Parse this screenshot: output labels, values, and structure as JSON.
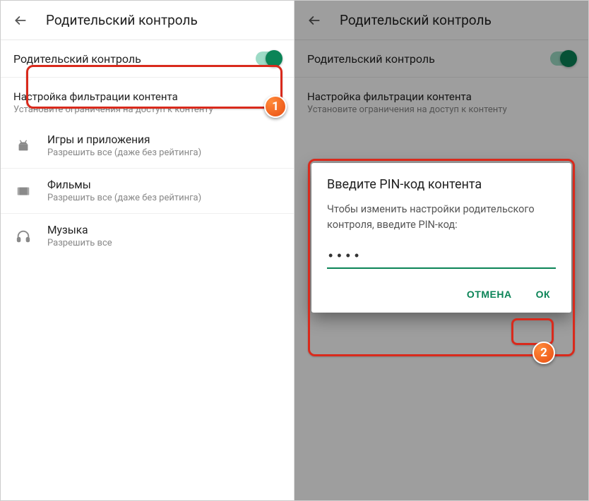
{
  "header_title": "Родительский контроль",
  "toggle_label": "Родительский контроль",
  "filter_section": {
    "title": "Настройка фильтрации контента",
    "sub": "Установите ограничения на доступ к контенту"
  },
  "items": [
    {
      "title": "Игры и приложения",
      "sub": "Разрешить все (даже без рейтинга)"
    },
    {
      "title": "Фильмы",
      "sub": "Разрешить все (даже без рейтинга)"
    },
    {
      "title": "Музыка",
      "sub": "Разрешить все"
    }
  ],
  "dialog": {
    "title": "Введите PIN-код контента",
    "body": "Чтобы изменить настройки родительского контроля, введите PIN-код:",
    "pin_value": "••••",
    "cancel": "ОТМЕНА",
    "ok": "ОК"
  },
  "badges": {
    "one": "1",
    "two": "2"
  }
}
